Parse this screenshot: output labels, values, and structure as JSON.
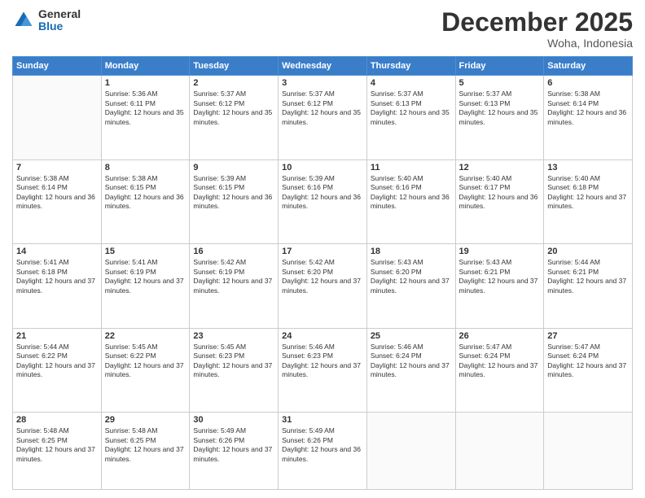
{
  "logo": {
    "general": "General",
    "blue": "Blue"
  },
  "header": {
    "month": "December 2025",
    "location": "Woha, Indonesia"
  },
  "weekdays": [
    "Sunday",
    "Monday",
    "Tuesday",
    "Wednesday",
    "Thursday",
    "Friday",
    "Saturday"
  ],
  "weeks": [
    [
      {
        "day": "",
        "sunrise": "",
        "sunset": "",
        "daylight": ""
      },
      {
        "day": "1",
        "sunrise": "Sunrise: 5:36 AM",
        "sunset": "Sunset: 6:11 PM",
        "daylight": "Daylight: 12 hours and 35 minutes."
      },
      {
        "day": "2",
        "sunrise": "Sunrise: 5:37 AM",
        "sunset": "Sunset: 6:12 PM",
        "daylight": "Daylight: 12 hours and 35 minutes."
      },
      {
        "day": "3",
        "sunrise": "Sunrise: 5:37 AM",
        "sunset": "Sunset: 6:12 PM",
        "daylight": "Daylight: 12 hours and 35 minutes."
      },
      {
        "day": "4",
        "sunrise": "Sunrise: 5:37 AM",
        "sunset": "Sunset: 6:13 PM",
        "daylight": "Daylight: 12 hours and 35 minutes."
      },
      {
        "day": "5",
        "sunrise": "Sunrise: 5:37 AM",
        "sunset": "Sunset: 6:13 PM",
        "daylight": "Daylight: 12 hours and 35 minutes."
      },
      {
        "day": "6",
        "sunrise": "Sunrise: 5:38 AM",
        "sunset": "Sunset: 6:14 PM",
        "daylight": "Daylight: 12 hours and 36 minutes."
      }
    ],
    [
      {
        "day": "7",
        "sunrise": "Sunrise: 5:38 AM",
        "sunset": "Sunset: 6:14 PM",
        "daylight": "Daylight: 12 hours and 36 minutes."
      },
      {
        "day": "8",
        "sunrise": "Sunrise: 5:38 AM",
        "sunset": "Sunset: 6:15 PM",
        "daylight": "Daylight: 12 hours and 36 minutes."
      },
      {
        "day": "9",
        "sunrise": "Sunrise: 5:39 AM",
        "sunset": "Sunset: 6:15 PM",
        "daylight": "Daylight: 12 hours and 36 minutes."
      },
      {
        "day": "10",
        "sunrise": "Sunrise: 5:39 AM",
        "sunset": "Sunset: 6:16 PM",
        "daylight": "Daylight: 12 hours and 36 minutes."
      },
      {
        "day": "11",
        "sunrise": "Sunrise: 5:40 AM",
        "sunset": "Sunset: 6:16 PM",
        "daylight": "Daylight: 12 hours and 36 minutes."
      },
      {
        "day": "12",
        "sunrise": "Sunrise: 5:40 AM",
        "sunset": "Sunset: 6:17 PM",
        "daylight": "Daylight: 12 hours and 36 minutes."
      },
      {
        "day": "13",
        "sunrise": "Sunrise: 5:40 AM",
        "sunset": "Sunset: 6:18 PM",
        "daylight": "Daylight: 12 hours and 37 minutes."
      }
    ],
    [
      {
        "day": "14",
        "sunrise": "Sunrise: 5:41 AM",
        "sunset": "Sunset: 6:18 PM",
        "daylight": "Daylight: 12 hours and 37 minutes."
      },
      {
        "day": "15",
        "sunrise": "Sunrise: 5:41 AM",
        "sunset": "Sunset: 6:19 PM",
        "daylight": "Daylight: 12 hours and 37 minutes."
      },
      {
        "day": "16",
        "sunrise": "Sunrise: 5:42 AM",
        "sunset": "Sunset: 6:19 PM",
        "daylight": "Daylight: 12 hours and 37 minutes."
      },
      {
        "day": "17",
        "sunrise": "Sunrise: 5:42 AM",
        "sunset": "Sunset: 6:20 PM",
        "daylight": "Daylight: 12 hours and 37 minutes."
      },
      {
        "day": "18",
        "sunrise": "Sunrise: 5:43 AM",
        "sunset": "Sunset: 6:20 PM",
        "daylight": "Daylight: 12 hours and 37 minutes."
      },
      {
        "day": "19",
        "sunrise": "Sunrise: 5:43 AM",
        "sunset": "Sunset: 6:21 PM",
        "daylight": "Daylight: 12 hours and 37 minutes."
      },
      {
        "day": "20",
        "sunrise": "Sunrise: 5:44 AM",
        "sunset": "Sunset: 6:21 PM",
        "daylight": "Daylight: 12 hours and 37 minutes."
      }
    ],
    [
      {
        "day": "21",
        "sunrise": "Sunrise: 5:44 AM",
        "sunset": "Sunset: 6:22 PM",
        "daylight": "Daylight: 12 hours and 37 minutes."
      },
      {
        "day": "22",
        "sunrise": "Sunrise: 5:45 AM",
        "sunset": "Sunset: 6:22 PM",
        "daylight": "Daylight: 12 hours and 37 minutes."
      },
      {
        "day": "23",
        "sunrise": "Sunrise: 5:45 AM",
        "sunset": "Sunset: 6:23 PM",
        "daylight": "Daylight: 12 hours and 37 minutes."
      },
      {
        "day": "24",
        "sunrise": "Sunrise: 5:46 AM",
        "sunset": "Sunset: 6:23 PM",
        "daylight": "Daylight: 12 hours and 37 minutes."
      },
      {
        "day": "25",
        "sunrise": "Sunrise: 5:46 AM",
        "sunset": "Sunset: 6:24 PM",
        "daylight": "Daylight: 12 hours and 37 minutes."
      },
      {
        "day": "26",
        "sunrise": "Sunrise: 5:47 AM",
        "sunset": "Sunset: 6:24 PM",
        "daylight": "Daylight: 12 hours and 37 minutes."
      },
      {
        "day": "27",
        "sunrise": "Sunrise: 5:47 AM",
        "sunset": "Sunset: 6:24 PM",
        "daylight": "Daylight: 12 hours and 37 minutes."
      }
    ],
    [
      {
        "day": "28",
        "sunrise": "Sunrise: 5:48 AM",
        "sunset": "Sunset: 6:25 PM",
        "daylight": "Daylight: 12 hours and 37 minutes."
      },
      {
        "day": "29",
        "sunrise": "Sunrise: 5:48 AM",
        "sunset": "Sunset: 6:25 PM",
        "daylight": "Daylight: 12 hours and 37 minutes."
      },
      {
        "day": "30",
        "sunrise": "Sunrise: 5:49 AM",
        "sunset": "Sunset: 6:26 PM",
        "daylight": "Daylight: 12 hours and 37 minutes."
      },
      {
        "day": "31",
        "sunrise": "Sunrise: 5:49 AM",
        "sunset": "Sunset: 6:26 PM",
        "daylight": "Daylight: 12 hours and 36 minutes."
      },
      {
        "day": "",
        "sunrise": "",
        "sunset": "",
        "daylight": ""
      },
      {
        "day": "",
        "sunrise": "",
        "sunset": "",
        "daylight": ""
      },
      {
        "day": "",
        "sunrise": "",
        "sunset": "",
        "daylight": ""
      }
    ]
  ]
}
